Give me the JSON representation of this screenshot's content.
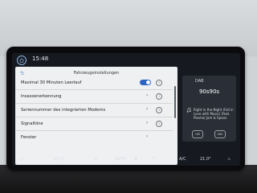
{
  "status": {
    "time": "15:48"
  },
  "panel": {
    "title": "Fahrzeugeinstellungen",
    "rows": [
      {
        "label": "Maximal 30 Minuten Leerlauf"
      },
      {
        "label": "Insassenerkennung"
      },
      {
        "label": "Seriennummer des integrierten Modems"
      },
      {
        "label": "Signaltöne"
      },
      {
        "label": "Fenster"
      }
    ]
  },
  "media": {
    "source": "DAB",
    "station": "90s90s",
    "song": "Right in the Night (Fall in Love with Music) (feat. Plavka) Jam & Spoon",
    "btn_a": "HM",
    "btn_b": "SNS"
  },
  "climate": {
    "left_temp": "21.0°",
    "auto": "AUTO",
    "ac": "A/C",
    "right_temp": "21.0°"
  },
  "colors": {
    "accent": "#2e63c4",
    "panel": "#eef0f2",
    "screen": "#161a20"
  }
}
